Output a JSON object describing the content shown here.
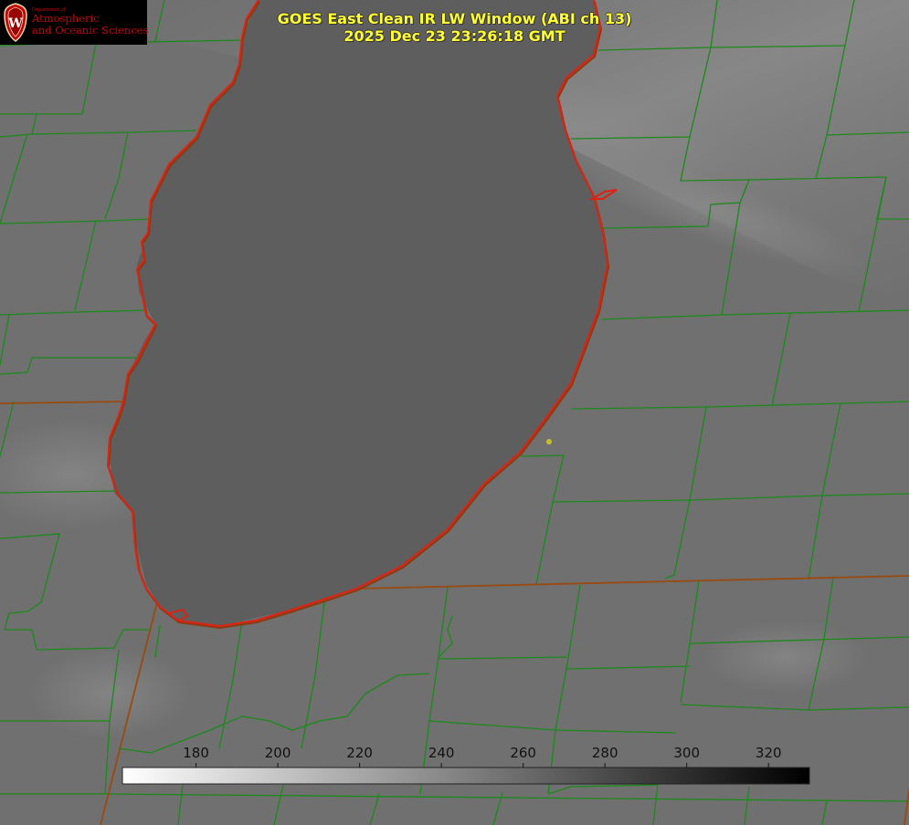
{
  "logo": {
    "department": "Department of",
    "line1": "Atmospheric",
    "line2": "and Oceanic Sciences",
    "crest_letter": "W",
    "color": "#c5050c"
  },
  "title": {
    "line1": "GOES East Clean IR LW Window (ABI ch 13)",
    "line2": "2025 Dec 23 23:26:18 GMT",
    "color": "#ffff33"
  },
  "map": {
    "lake_outline_color": "#e02010",
    "county_border_color": "#1a8a1a",
    "state_border_color": "#9a4a10",
    "station_marker_color": "#c8c020"
  },
  "colorbar": {
    "ticks": [
      "180",
      "200",
      "220",
      "240",
      "260",
      "280",
      "300",
      "320"
    ],
    "min_value": 162,
    "max_value": 330,
    "low_color": "#ffffff",
    "high_color": "#000000"
  }
}
